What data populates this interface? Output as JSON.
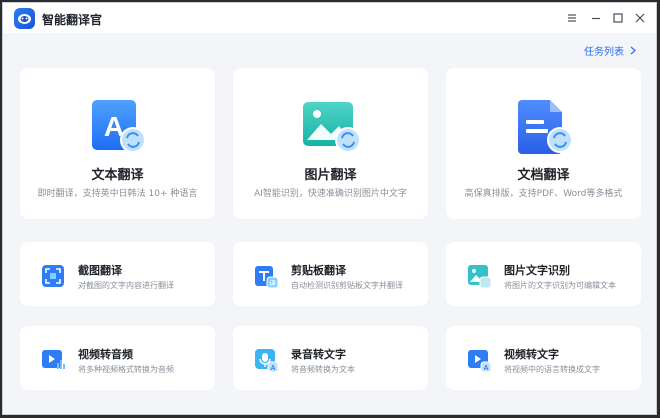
{
  "app": {
    "title": "智能翻译官"
  },
  "header": {
    "task_list_label": "任务列表"
  },
  "big_cards": [
    {
      "title": "文本翻译",
      "desc": "即时翻译，支持英中日韩法 10+ 种语言",
      "icon": "text-translate-icon"
    },
    {
      "title": "图片翻译",
      "desc": "AI智能识别，快速准确识别图片中文字",
      "icon": "image-translate-icon"
    },
    {
      "title": "文档翻译",
      "desc": "高保真排版，支持PDF、Word等多格式",
      "icon": "document-translate-icon"
    }
  ],
  "small_cards": [
    {
      "title": "截图翻译",
      "desc": "对截图的文字内容进行翻译",
      "icon": "screenshot-translate-icon"
    },
    {
      "title": "剪贴板翻译",
      "desc": "自动检测识别剪贴板文字并翻译",
      "icon": "clipboard-translate-icon"
    },
    {
      "title": "图片文字识别",
      "desc": "将图片的文字识别为可编辑文本",
      "icon": "image-ocr-icon"
    },
    {
      "title": "视频转音频",
      "desc": "将多种视频格式转换为音频",
      "icon": "video-to-audio-icon"
    },
    {
      "title": "录音转文字",
      "desc": "将音频转换为文本",
      "icon": "audio-to-text-icon"
    },
    {
      "title": "视频转文字",
      "desc": "将视频中的语言转换成文字",
      "icon": "video-to-text-icon"
    }
  ],
  "colors": {
    "accent": "#2b6fe8",
    "background": "#f3f5f9"
  }
}
